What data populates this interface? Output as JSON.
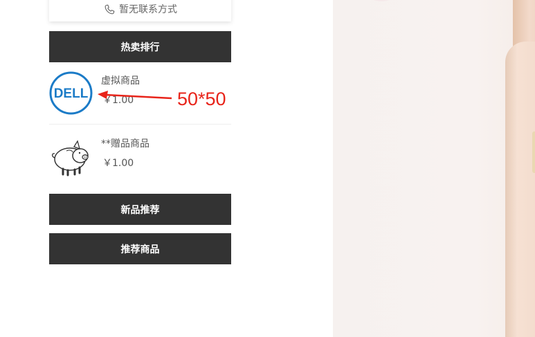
{
  "contact": {
    "text": "暂无联系方式",
    "icon": "phone-icon"
  },
  "sections": {
    "hot": "热卖排行",
    "new": "新品推荐",
    "recommended": "推荐商品"
  },
  "products": [
    {
      "name": "虚拟商品",
      "price": "￥1.00",
      "image": "dell-logo"
    },
    {
      "name": "**赠品商品",
      "price": "￥1.00",
      "image": "pig-cartoon"
    }
  ],
  "annotation": {
    "text": "50*50",
    "color": "#e8241a"
  },
  "colors": {
    "header_bg": "#333333",
    "header_text": "#ffffff",
    "text": "#555555"
  }
}
